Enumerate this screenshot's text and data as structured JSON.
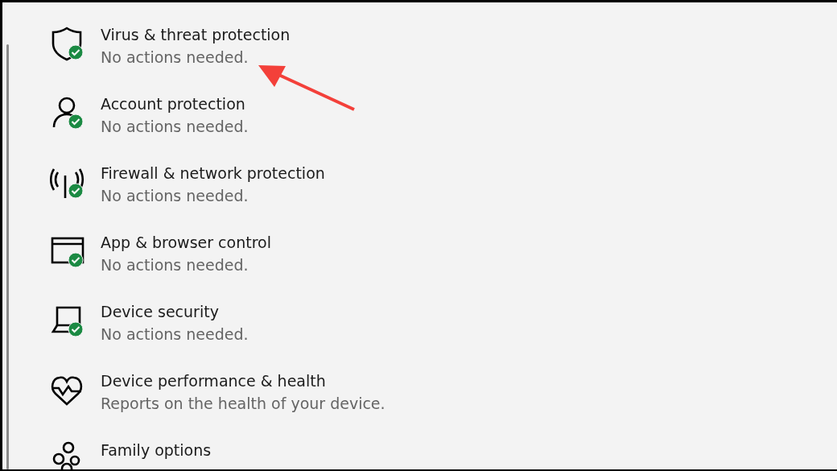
{
  "items": [
    {
      "title": "Virus & threat protection",
      "subtitle": "No actions needed.",
      "badge": true
    },
    {
      "title": "Account protection",
      "subtitle": "No actions needed.",
      "badge": true
    },
    {
      "title": "Firewall & network protection",
      "subtitle": "No actions needed.",
      "badge": true
    },
    {
      "title": "App & browser control",
      "subtitle": "No actions needed.",
      "badge": true
    },
    {
      "title": "Device security",
      "subtitle": "No actions needed.",
      "badge": true
    },
    {
      "title": "Device performance & health",
      "subtitle": "Reports on the health of your device.",
      "badge": false
    },
    {
      "title": "Family options",
      "badge": false
    }
  ],
  "annotation": {
    "kind": "arrow"
  }
}
